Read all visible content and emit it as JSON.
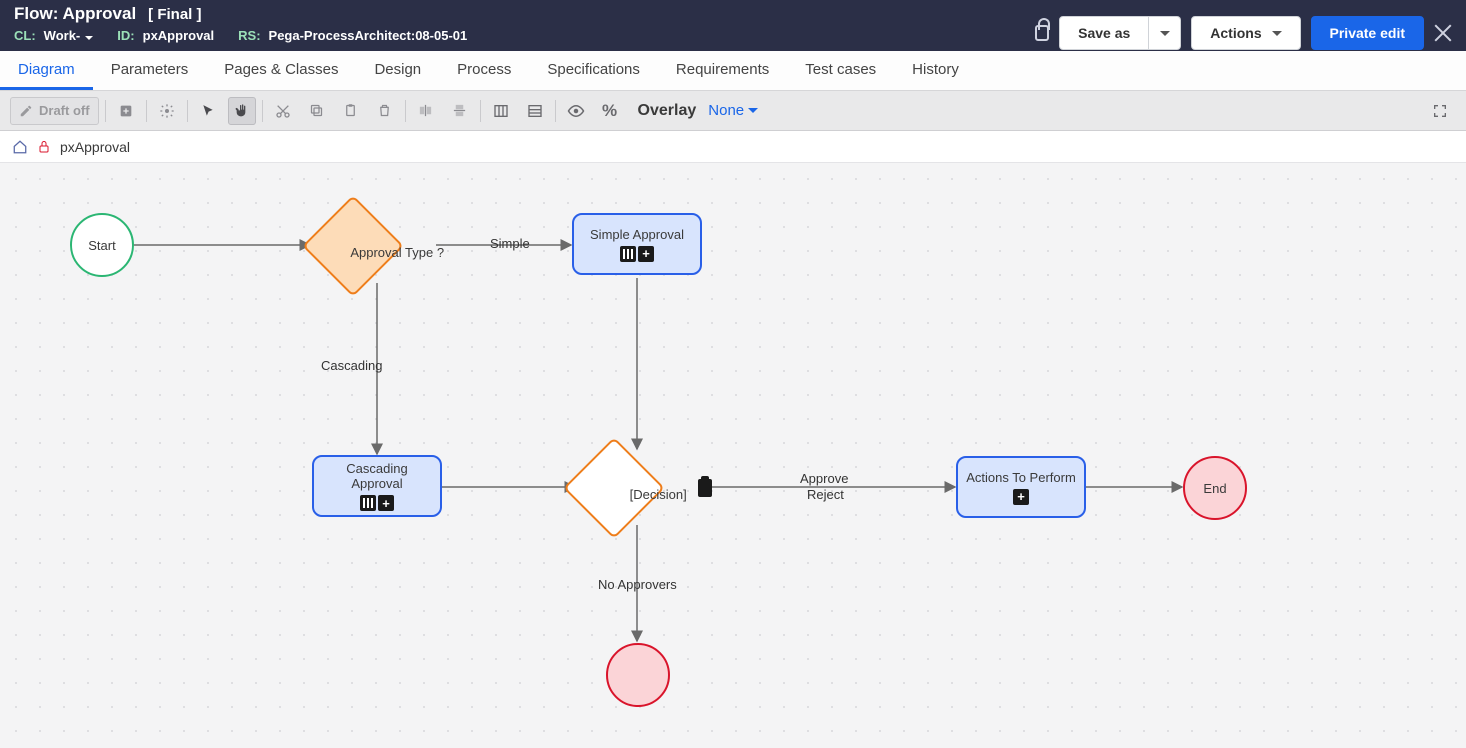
{
  "header": {
    "prefix": "Flow:",
    "name": "Approval",
    "final": "[ Final ]",
    "cl_label": "CL:",
    "cl_value": "Work-",
    "id_label": "ID:",
    "id_value": "pxApproval",
    "rs_label": "RS:",
    "rs_value": "Pega-ProcessArchitect:08-05-01",
    "save_as": "Save as",
    "actions": "Actions",
    "private_edit": "Private edit"
  },
  "tabs": [
    "Diagram",
    "Parameters",
    "Pages & Classes",
    "Design",
    "Process",
    "Specifications",
    "Requirements",
    "Test cases",
    "History"
  ],
  "active_tab": 0,
  "toolbar": {
    "draft": "Draft off",
    "overlay_label": "Overlay",
    "overlay_value": "None"
  },
  "breadcrumb": {
    "name": "pxApproval"
  },
  "diagram": {
    "nodes": {
      "start": {
        "label": "Start"
      },
      "approval_type": {
        "label": "Approval Type ?"
      },
      "simple_approval": {
        "label": "Simple Approval"
      },
      "cascading_approval": {
        "line1": "Cascading",
        "line2": "Approval"
      },
      "decision": {
        "label": "[Decision]"
      },
      "actions_perform": {
        "label": "Actions To Perform"
      },
      "end": {
        "label": "End"
      }
    },
    "edges": {
      "simple": "Simple",
      "cascading": "Cascading",
      "approve": "Approve",
      "reject": "Reject",
      "no_approvers": "No Approvers"
    }
  }
}
